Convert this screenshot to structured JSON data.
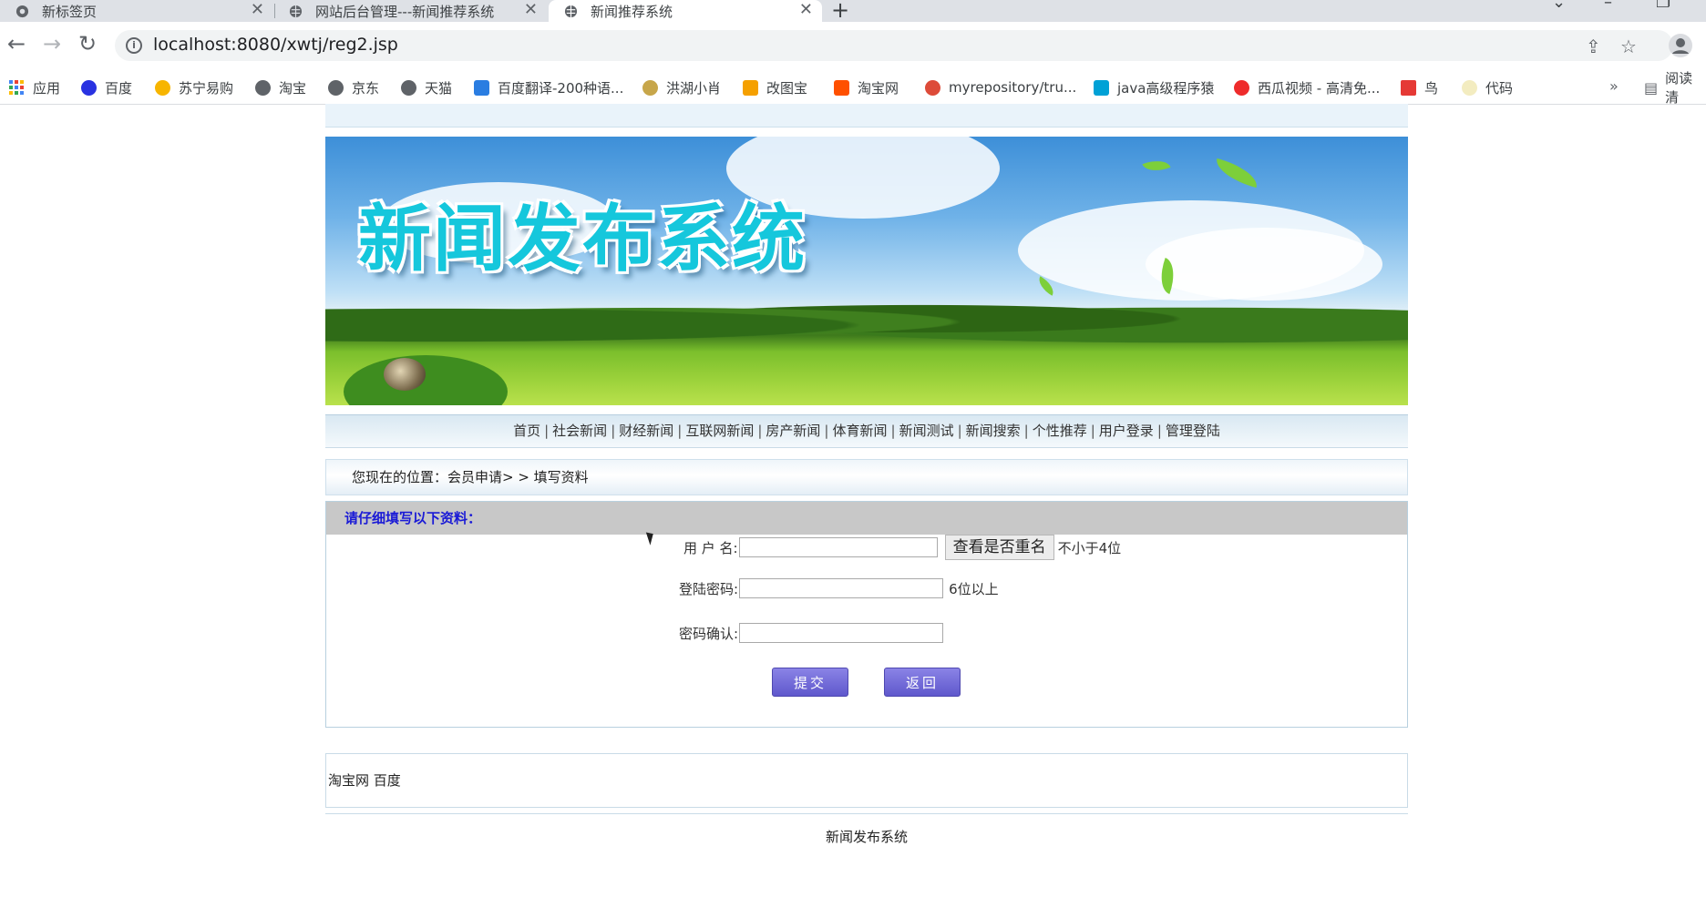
{
  "browser": {
    "tabs": [
      {
        "label": "新标签页"
      },
      {
        "label": "网站后台管理---新闻推荐系统"
      },
      {
        "label": "新闻推荐系统"
      }
    ],
    "url": "localhost:8080/xwtj/reg2.jsp",
    "bookmarks": [
      {
        "label": "应用"
      },
      {
        "label": "百度"
      },
      {
        "label": "苏宁易购"
      },
      {
        "label": "淘宝"
      },
      {
        "label": "京东"
      },
      {
        "label": "天猫"
      },
      {
        "label": "百度翻译-200种语..."
      },
      {
        "label": "洪湖小肖"
      },
      {
        "label": "改图宝"
      },
      {
        "label": "淘宝网"
      },
      {
        "label": "myrepository/tru..."
      },
      {
        "label": "java高级程序猿"
      },
      {
        "label": "西瓜视频 - 高清免..."
      },
      {
        "label": "鸟"
      },
      {
        "label": "代码"
      }
    ],
    "bookmarks_more": "»",
    "reading_list": "阅读清"
  },
  "page": {
    "banner_title": "新闻发布系统",
    "nav": [
      "首页",
      "社会新闻",
      "财经新闻",
      "互联网新闻",
      "房产新闻",
      "体育新闻",
      "新闻测试",
      "新闻搜索",
      "个性推荐",
      "用户登录",
      "管理登陆"
    ],
    "breadcrumb": "您现在的位置：会员申请> > 填写资料",
    "form_heading": "请仔细填写以下资料：",
    "form": {
      "username_label": "用 户 名:",
      "username_value": "",
      "check_button": "查看是否重名",
      "username_hint": "不小于4位",
      "password_label": "登陆密码:",
      "password_value": "",
      "password_hint": "6位以上",
      "confirm_label": "密码确认:",
      "confirm_value": "",
      "submit": "提交",
      "back": "返回"
    },
    "links": "淘宝网 百度",
    "footer": "新闻发布系统"
  },
  "colors": {
    "tab_bar": "#dee1e6",
    "banner_title": "#15c7dc",
    "form_heading_text": "#1a1ad6",
    "form_heading_bg": "#c8c8c8",
    "button": "#6b64d8"
  }
}
